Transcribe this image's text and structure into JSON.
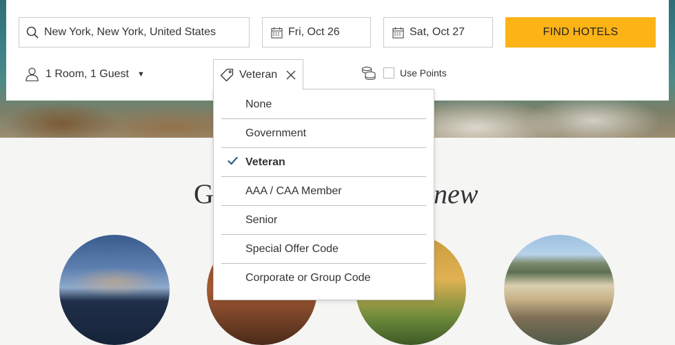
{
  "search": {
    "destination": "New York, New York, United States",
    "checkin": "Fri, Oct 26",
    "checkout": "Sat, Oct 27",
    "find_label": "FIND HOTELS"
  },
  "guests": {
    "label": "1 Room, 1 Guest"
  },
  "special_rate": {
    "selected": "Veteran"
  },
  "points": {
    "label": "Use Points",
    "checked": false
  },
  "rate_options": [
    "None",
    "Government",
    "Veteran",
    "AAA / CAA Member",
    "Senior",
    "Special Offer Code",
    "Corporate or Group Code"
  ],
  "section": {
    "heading_left": "G",
    "heading_right": "new"
  },
  "colors": {
    "accent": "#fbb315",
    "check": "#2b5f8a"
  },
  "icons": [
    "search-icon",
    "calendar-icon",
    "user-icon",
    "tag-icon",
    "close-icon",
    "coins-icon",
    "checkmark-icon"
  ]
}
